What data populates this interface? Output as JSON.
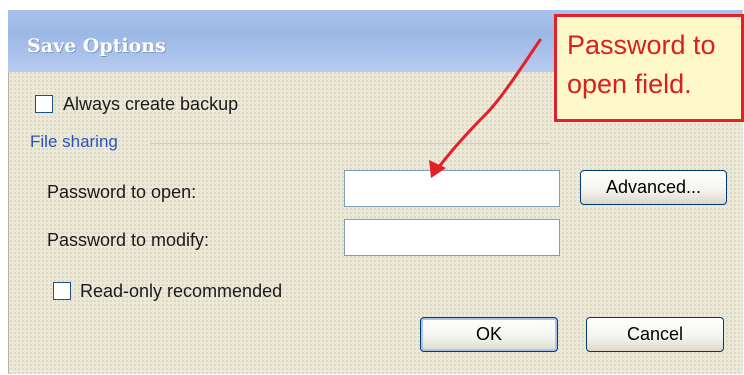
{
  "dialog": {
    "title": "Save Options",
    "always_backup_label": "Always create backup",
    "file_sharing_heading": "File sharing",
    "password_open_label": "Password to open:",
    "password_open_value": "",
    "password_modify_label": "Password to modify:",
    "password_modify_value": "",
    "read_only_label": "Read-only recommended",
    "advanced_button": "Advanced...",
    "ok_button": "OK",
    "cancel_button": "Cancel"
  },
  "annotation": {
    "line1": "Password to",
    "line2": "open field.",
    "color": "#e2202a"
  }
}
